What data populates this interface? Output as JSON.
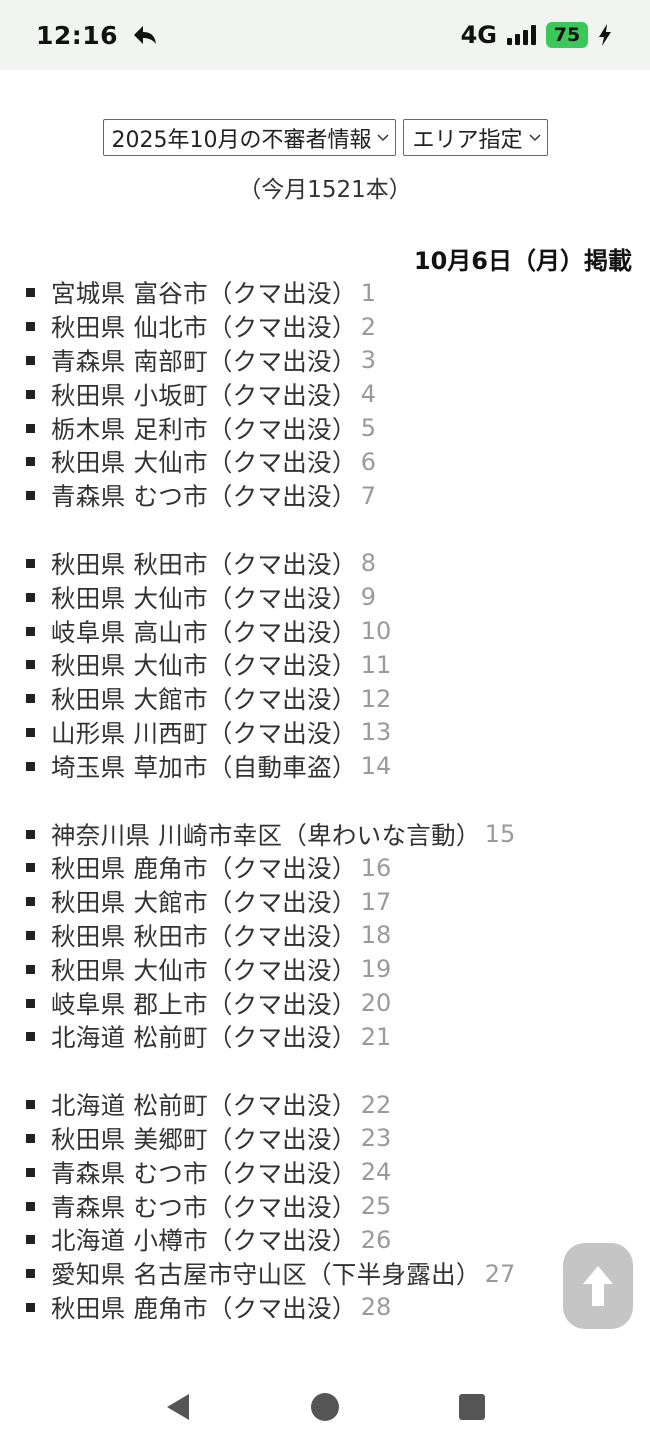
{
  "status": {
    "time": "12:16",
    "network": "4G",
    "battery": "75"
  },
  "controls": {
    "month_select": "2025年10月の不審者情報",
    "area_select": "エリア指定"
  },
  "count_text": "（今月1521本）",
  "date_heading": "10月6日（月）掲載",
  "groups": [
    [
      {
        "text": "宮城県 富谷市（クマ出没）",
        "num": "1"
      },
      {
        "text": "秋田県 仙北市（クマ出没）",
        "num": "2"
      },
      {
        "text": "青森県 南部町（クマ出没）",
        "num": "3"
      },
      {
        "text": "秋田県 小坂町（クマ出没）",
        "num": "4"
      },
      {
        "text": "栃木県 足利市（クマ出没）",
        "num": "5"
      },
      {
        "text": "秋田県 大仙市（クマ出没）",
        "num": "6"
      },
      {
        "text": "青森県 むつ市（クマ出没）",
        "num": "7"
      }
    ],
    [
      {
        "text": "秋田県 秋田市（クマ出没）",
        "num": "8"
      },
      {
        "text": "秋田県 大仙市（クマ出没）",
        "num": "9"
      },
      {
        "text": "岐阜県 高山市（クマ出没）",
        "num": "10"
      },
      {
        "text": "秋田県 大仙市（クマ出没）",
        "num": "11"
      },
      {
        "text": "秋田県 大館市（クマ出没）",
        "num": "12"
      },
      {
        "text": "山形県 川西町（クマ出没）",
        "num": "13"
      },
      {
        "text": "埼玉県 草加市（自動車盗）",
        "num": "14"
      }
    ],
    [
      {
        "text": "神奈川県 川崎市幸区（卑わいな言動）",
        "num": "15"
      },
      {
        "text": "秋田県 鹿角市（クマ出没）",
        "num": "16"
      },
      {
        "text": "秋田県 大館市（クマ出没）",
        "num": "17"
      },
      {
        "text": "秋田県 秋田市（クマ出没）",
        "num": "18"
      },
      {
        "text": "秋田県 大仙市（クマ出没）",
        "num": "19"
      },
      {
        "text": "岐阜県 郡上市（クマ出没）",
        "num": "20"
      },
      {
        "text": "北海道 松前町（クマ出没）",
        "num": "21"
      }
    ],
    [
      {
        "text": "北海道 松前町（クマ出没）",
        "num": "22"
      },
      {
        "text": "秋田県 美郷町（クマ出没）",
        "num": "23"
      },
      {
        "text": "青森県 むつ市（クマ出没）",
        "num": "24"
      },
      {
        "text": "青森県 むつ市（クマ出没）",
        "num": "25"
      },
      {
        "text": "北海道 小樽市（クマ出没）",
        "num": "26"
      },
      {
        "text": "愛知県 名古屋市守山区（下半身露出）",
        "num": "27"
      },
      {
        "text": "秋田県 鹿角市（クマ出没）",
        "num": "28"
      }
    ]
  ],
  "icons": {
    "back": "reply-arrow-icon",
    "charging": "bolt-icon",
    "scroll_top": "arrow-up-icon",
    "nav_back": "triangle-back-icon",
    "nav_home": "circle-home-icon",
    "nav_recents": "square-recents-icon"
  }
}
